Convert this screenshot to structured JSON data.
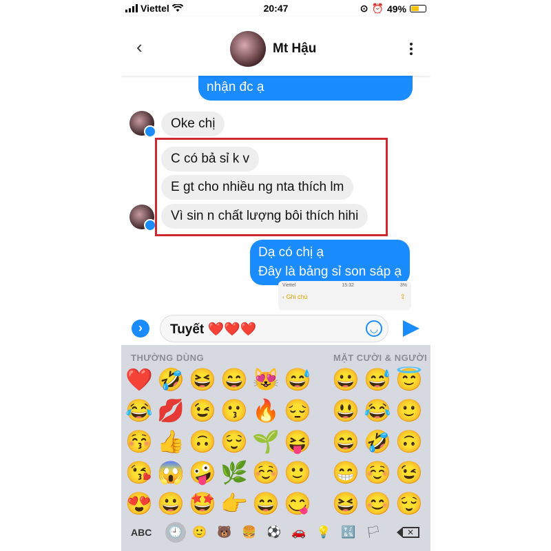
{
  "status_bar": {
    "carrier": "Viettel",
    "time": "20:47",
    "battery": "49%"
  },
  "header": {
    "name": "Mt Hậu"
  },
  "messages": [
    {
      "dir": "out",
      "text": "nhận đc ạ"
    },
    {
      "dir": "in",
      "text": "Oke chị"
    },
    {
      "dir": "in",
      "text": "C có bả sỉ k v"
    },
    {
      "dir": "in",
      "text": "E gt cho nhiều ng nta thích lm"
    },
    {
      "dir": "in",
      "text": "Vì sin n chất lượng bôi thích hihi"
    },
    {
      "dir": "out",
      "text": "Dạ có chị ạ"
    },
    {
      "dir": "out",
      "text": "Đây là bảng sỉ son sáp ạ"
    }
  ],
  "shared_image": {
    "carrier": "Viettel",
    "time": "15:32",
    "battery": "3%",
    "back_label": "Ghi chú"
  },
  "composer": {
    "value": "Tuyết ❤️❤️❤️"
  },
  "keyboard": {
    "section_frequent": "THƯỜNG DÙNG",
    "section_smileys": "MẶT CƯỜI & NGƯỜI",
    "abc_label": "ABC",
    "frequent": [
      [
        "❤️",
        "🤣",
        "😆",
        "😄",
        "😻",
        "😅"
      ],
      [
        "😂",
        "💋",
        "😉",
        "😗",
        "🔥",
        "😔"
      ],
      [
        "😚",
        "👍",
        "🙃",
        "😌",
        "🌱",
        "😝"
      ],
      [
        "😘",
        "😱",
        "🤪",
        "🌿",
        "☺️",
        "🙂"
      ],
      [
        "😍",
        "😀",
        "🤩",
        "👉",
        "😄",
        "😋"
      ]
    ],
    "smileys": [
      [
        "😀",
        "😅",
        "😇"
      ],
      [
        "😃",
        "😂",
        "🙂"
      ],
      [
        "😄",
        "🤣",
        "🙃"
      ],
      [
        "😁",
        "☺️",
        "😉"
      ],
      [
        "😆",
        "😊",
        "😌"
      ]
    ],
    "categories": [
      "🕘",
      "🙂",
      "🐻",
      "🍔",
      "⚽",
      "🚗",
      "💡",
      "🔣",
      "🏳"
    ]
  }
}
